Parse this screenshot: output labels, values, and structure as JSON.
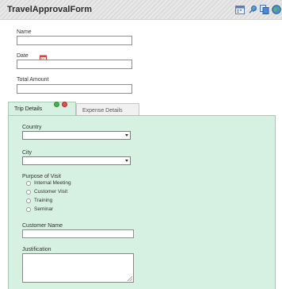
{
  "form": {
    "title": "TravelApprovalForm",
    "toolbar_icons": [
      "calendar-icon",
      "pin-icon",
      "copy-icon",
      "globe-icon"
    ]
  },
  "fields": {
    "name_label": "Name",
    "name_value": "",
    "date_label": "Date",
    "date_value": "",
    "total_label": "Total Amount",
    "total_value": ""
  },
  "tabs": [
    {
      "label": "Trip Details"
    },
    {
      "label": "Expense Details"
    }
  ],
  "trip": {
    "country_label": "Country",
    "country_value": "",
    "city_label": "City",
    "city_value": "",
    "purpose_label": "Purpose of Visit",
    "purpose_options": [
      "Internal Meeting",
      "Customer Visit",
      "Training",
      "Seminar"
    ],
    "customer_label": "Customer Name",
    "customer_value": "",
    "justification_label": "Justification",
    "justification_value": ""
  },
  "colors": {
    "panel_bg": "#d6f0e2",
    "panel_border": "#a8c9b6",
    "add_green": "#4caf50",
    "remove_red": "#e05050"
  }
}
